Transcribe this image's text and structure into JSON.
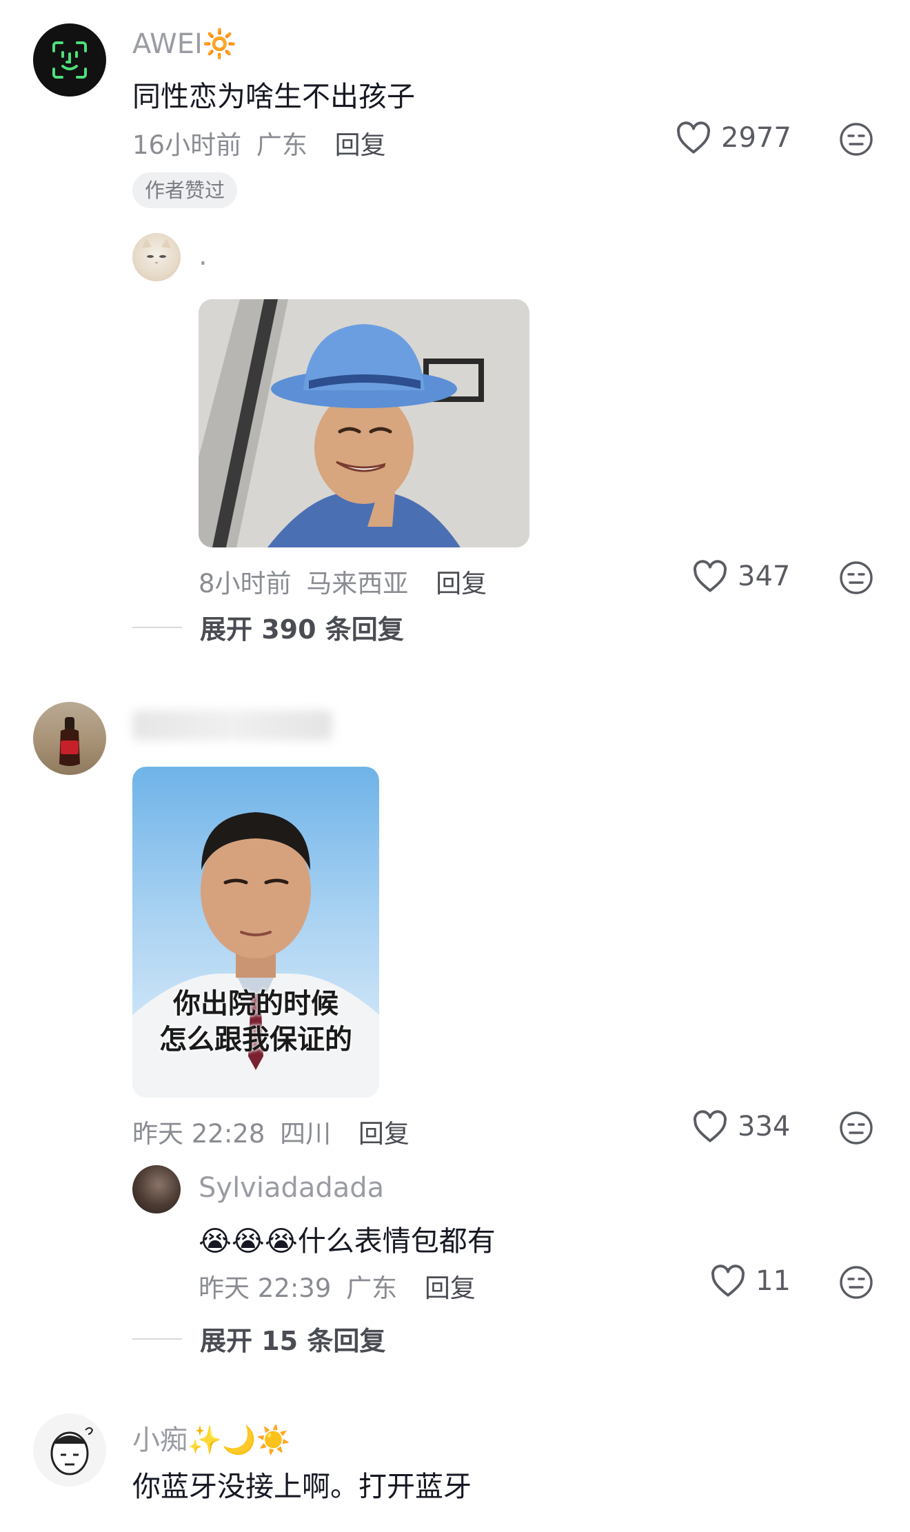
{
  "comments": [
    {
      "username": "AWEI",
      "username_emoji": "🔆",
      "text": "同性恋为啥生不出孩子",
      "time": "16小时前",
      "location": "广东",
      "reply_label": "回复",
      "likes": "2977",
      "badge": "作者赞过",
      "replies": [
        {
          "username": ".",
          "time": "8小时前",
          "location": "马来西亚",
          "reply_label": "回复",
          "likes": "347"
        }
      ],
      "expand_label": "展开 390 条回复"
    },
    {
      "time": "昨天 22:28",
      "location": "四川",
      "reply_label": "回复",
      "likes": "334",
      "image_caption_1": "你出院的时候",
      "image_caption_2": "怎么跟我保证的",
      "replies": [
        {
          "username": "Sylviadadada",
          "emojis": "😭😭😭",
          "text": "什么表情包都有",
          "time": "昨天 22:39",
          "location": "广东",
          "reply_label": "回复",
          "likes": "11"
        }
      ],
      "expand_label": "展开 15 条回复"
    },
    {
      "username": "小痴",
      "username_emoji": "✨🌙☀️",
      "text": "你蓝牙没接上啊。打开蓝牙"
    }
  ],
  "colors": {
    "text_primary": "#161823",
    "text_secondary": "#8a8c93",
    "heart_stroke": "#5a5c63"
  }
}
